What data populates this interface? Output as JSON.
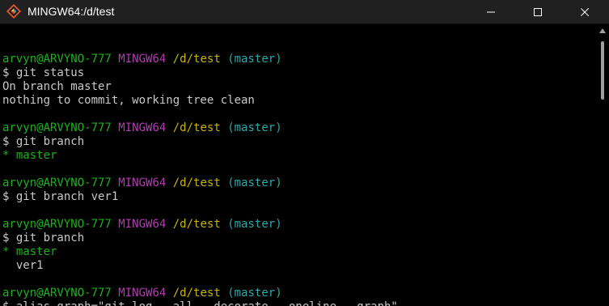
{
  "window": {
    "title": "MINGW64:/d/test",
    "controls": {
      "minimize_icon": "minimize-icon",
      "maximize_icon": "maximize-icon",
      "close_icon": "close-icon"
    }
  },
  "colors": {
    "user": "#1cb11c",
    "host": "#b03cb0",
    "path": "#c7b300",
    "branch": "#2aa7a7",
    "text": "#c8c8c8",
    "titlebar": "#202020"
  },
  "terminal": {
    "lines": [
      {
        "kind": "blank"
      },
      {
        "kind": "prompt",
        "user": "arvyn@ARVYNO-777",
        "host": "MINGW64",
        "path": "/d/test",
        "branch": "(master)"
      },
      {
        "kind": "text",
        "text": "$ git status"
      },
      {
        "kind": "text",
        "text": "On branch master"
      },
      {
        "kind": "text",
        "text": "nothing to commit, working tree clean"
      },
      {
        "kind": "blank"
      },
      {
        "kind": "prompt",
        "user": "arvyn@ARVYNO-777",
        "host": "MINGW64",
        "path": "/d/test",
        "branch": "(master)"
      },
      {
        "kind": "text",
        "text": "$ git branch"
      },
      {
        "kind": "current-branch",
        "text": "* master"
      },
      {
        "kind": "blank"
      },
      {
        "kind": "prompt",
        "user": "arvyn@ARVYNO-777",
        "host": "MINGW64",
        "path": "/d/test",
        "branch": "(master)"
      },
      {
        "kind": "text",
        "text": "$ git branch ver1"
      },
      {
        "kind": "blank"
      },
      {
        "kind": "prompt",
        "user": "arvyn@ARVYNO-777",
        "host": "MINGW64",
        "path": "/d/test",
        "branch": "(master)"
      },
      {
        "kind": "text",
        "text": "$ git branch"
      },
      {
        "kind": "current-branch",
        "text": "* master"
      },
      {
        "kind": "text",
        "text": "  ver1"
      },
      {
        "kind": "blank"
      },
      {
        "kind": "prompt",
        "user": "arvyn@ARVYNO-777",
        "host": "MINGW64",
        "path": "/d/test",
        "branch": "(master)"
      },
      {
        "kind": "text",
        "text": "$ alias graph=\"git log --all --decorate --oneline --graph\""
      }
    ]
  },
  "scrollbar": {
    "up_icon": "scroll-up-arrow-icon"
  }
}
